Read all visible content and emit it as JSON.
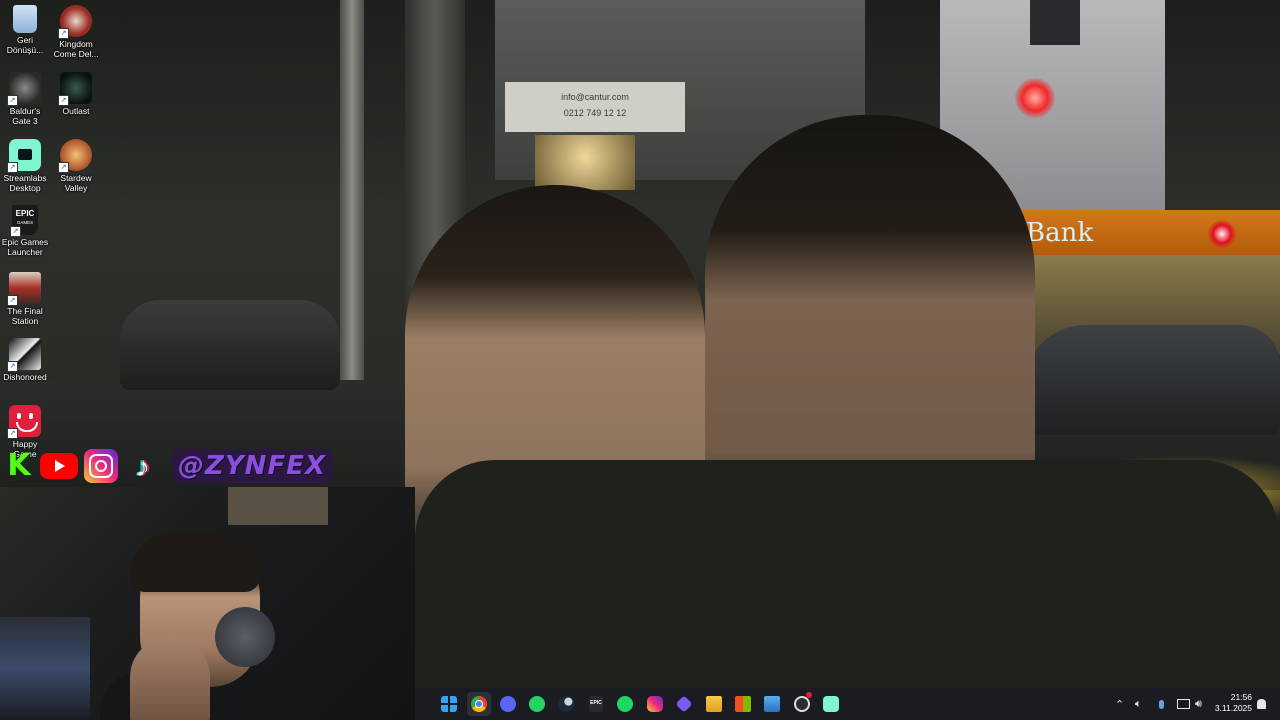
{
  "desktop": {
    "icons": [
      {
        "id": "recycle",
        "label": "Geri Dönüşü...",
        "icon": "recycle-bin-icon"
      },
      {
        "id": "kingdom",
        "label": "Kingdom Come Del...",
        "icon": "kingdom-come-icon"
      },
      {
        "id": "baldurs",
        "label": "Baldur's Gate 3",
        "icon": "baldurs-gate-icon"
      },
      {
        "id": "outlast",
        "label": "Outlast",
        "icon": "outlast-icon"
      },
      {
        "id": "streamlabs",
        "label": "Streamlabs Desktop",
        "icon": "streamlabs-icon"
      },
      {
        "id": "stardew",
        "label": "Stardew Valley",
        "icon": "stardew-valley-icon"
      },
      {
        "id": "epic",
        "label": "Epic Games Launcher",
        "icon": "epic-games-icon"
      },
      {
        "id": "finalstation",
        "label": "The Final Station",
        "icon": "final-station-icon"
      },
      {
        "id": "dishonored",
        "label": "Dishonored",
        "icon": "dishonored-icon"
      },
      {
        "id": "happygame",
        "label": "Happy Game",
        "icon": "happy-game-icon"
      }
    ],
    "epic_glyph_text": "EPIC\nGAMES"
  },
  "wallpaper": {
    "bank_sign": "Bank",
    "sign_line1": "info@cantur.com",
    "sign_line2": "0212 749 12 12"
  },
  "overlay": {
    "handle": "@ZYNFEX",
    "kick_letter": "K"
  },
  "taskbar": {
    "apps": [
      {
        "name": "start-button",
        "icon": "windows-start-icon"
      },
      {
        "name": "chrome-button",
        "icon": "chrome-icon"
      },
      {
        "name": "discord-button",
        "icon": "discord-icon"
      },
      {
        "name": "whatsapp-button",
        "icon": "whatsapp-icon"
      },
      {
        "name": "steam-button",
        "icon": "steam-icon"
      },
      {
        "name": "epic-button",
        "icon": "epic-games-icon"
      },
      {
        "name": "spotify-button",
        "icon": "spotify-icon"
      },
      {
        "name": "instagram-button",
        "icon": "instagram-icon"
      },
      {
        "name": "proton-button",
        "icon": "diamond-icon"
      },
      {
        "name": "explorer-button",
        "icon": "file-explorer-icon"
      },
      {
        "name": "store-button",
        "icon": "microsoft-store-icon"
      },
      {
        "name": "photos-button",
        "icon": "photos-icon"
      },
      {
        "name": "obs-button",
        "icon": "obs-icon"
      },
      {
        "name": "streamlabs-button",
        "icon": "streamlabs-icon"
      }
    ],
    "epic_text": "EPIC",
    "clock_time": "21:56",
    "clock_date": "3.11.2025"
  },
  "colors": {
    "taskbar_bg": "#1b1c22",
    "handle_purple": "#8a4fe0",
    "kick_green": "#53fc18",
    "youtube_red": "#ff0000"
  }
}
